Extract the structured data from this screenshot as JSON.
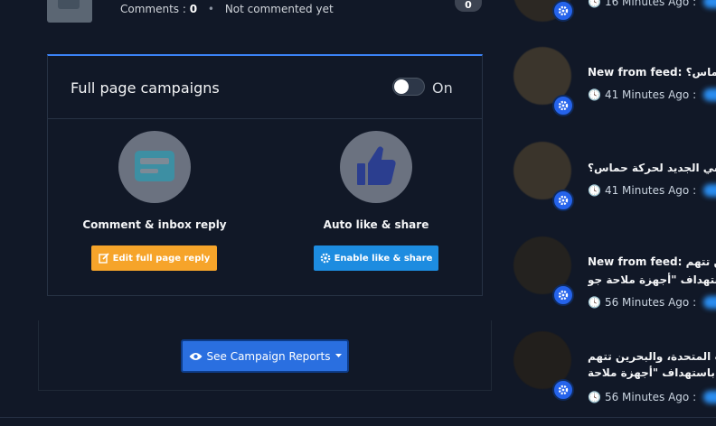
{
  "top_row": {
    "comments_label": "Comments :",
    "comments_count": "0",
    "dot": "•",
    "status": "Not commented yet",
    "badge": "0"
  },
  "campaigns": {
    "title": "Full page campaigns",
    "toggle_state": "On",
    "features": [
      {
        "label": "Comment & inbox reply",
        "button": "Edit full page reply",
        "icon": "card-icon",
        "button_icon": "edit-icon"
      },
      {
        "label": "Auto like & share",
        "button": "Enable like & share",
        "icon": "thumbs-up-icon",
        "button_icon": "gear-icon"
      }
    ]
  },
  "reports": {
    "button": "See Campaign Reports"
  },
  "feed": [
    {
      "title": "",
      "time": "16 Minutes Ago :"
    },
    {
      "title": "New from feed: ة حماس؟",
      "time": "41 Minutes Ago :"
    },
    {
      "title": "ياسي الجديد لحركة حماس؟",
      "time": "41 Minutes Ago :"
    },
    {
      "title": "New from feed: حرين تتهم",
      "title2": "باستهداف \"أجهزة ملاحة جو",
      "time": "56 Minutes Ago :"
    },
    {
      "title": "يات المتحدة، والبحرين تتهم",
      "title2": "يران باستهداف \"أجهزة ملاحة",
      "time": "56 Minutes Ago :"
    }
  ],
  "colors": {
    "accent": "#3b82f6",
    "orange": "#f6a42a",
    "blue_button": "#1d8ce0",
    "bg": "#111827"
  }
}
